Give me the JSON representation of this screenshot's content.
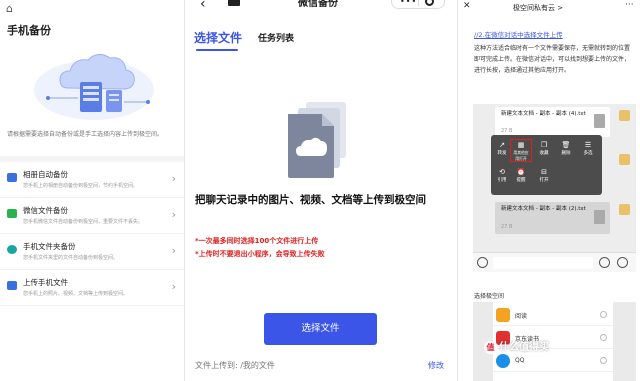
{
  "left": {
    "home_glyph": "⌂",
    "title": "手机备份",
    "description": "请根据需要选择自动备份或是手工选择内容上传到极空间。",
    "items": [
      {
        "name": "相册自动备份",
        "sub": "您手机上的相册自动备份到极空间，节约手机空间。",
        "icon": "album-icon",
        "color": "#3a6fe0"
      },
      {
        "name": "微信文件备份",
        "sub": "您手机微信文件自动备份到极空间，重要文件不丢失。",
        "icon": "wechat-file-icon",
        "color": "#2ab34d"
      },
      {
        "name": "手机文件夹备份",
        "sub": "您手机文件夹里的文件自动备份到极空间。",
        "icon": "folder-sync-icon",
        "color": "#1aa6a0"
      },
      {
        "name": "上传手机文件",
        "sub": "您手机上的照片、视频、文档等上传到极空间。",
        "icon": "upload-folder-icon",
        "color": "#3a6fe0"
      }
    ],
    "chevron": "›"
  },
  "middle": {
    "nav_title": "微信备份",
    "back_glyph": "‹",
    "capsule_dots": "•••",
    "tabs": [
      "选择文件",
      "任务列表"
    ],
    "headline": "把聊天记录中的图片、视频、文档等上传到极空间",
    "warnings": [
      "*一次最多同时选择100个文件进行上传",
      "*上传时不要退出小程序，会导致上传失败"
    ],
    "select_button": "选择文件",
    "upload_to": "文件上传到: /我的文件",
    "modify": "修改",
    "accent": "#3a55e8",
    "warn_color": "#e02020"
  },
  "right": {
    "close_glyph": "✕",
    "title": "极空间私有云 >",
    "more_glyph": "···",
    "section1": "//2.在微信对话中选择文件上传",
    "paragraph": "这种方法适合临时有一个文件需要保存，无需就转到的位置即可完成上传。在微信对话中，可以找到想要上传的文件，进行长按，选择通过其他应用打开。",
    "chat": {
      "bubble1_title": "新建文本文档 - 副本 - 副本 (4).txt",
      "bubble1_size": "27 B",
      "bubble2_title": "新建文本文档 - 副本 - 副本 (2).txt",
      "bubble2_size": "27 B",
      "menu_items": [
        {
          "glyph": "↗",
          "label": "转发"
        },
        {
          "glyph": "▦",
          "label": "用其他应用打开"
        },
        {
          "glyph": "❒",
          "label": "收藏"
        },
        {
          "glyph": "🗑",
          "label": "删除"
        },
        {
          "glyph": "☰",
          "label": "多选"
        },
        {
          "glyph": "⟲",
          "label": "引用"
        },
        {
          "glyph": "⏰",
          "label": "提醒"
        },
        {
          "glyph": "⊟",
          "label": "打开"
        }
      ]
    },
    "section2": "选择极空间",
    "apps": [
      {
        "name": "阅读",
        "color": "#f3a321"
      },
      {
        "name": "京东读书",
        "color": "#e03030"
      },
      {
        "name": "QQ",
        "color": "#1b8fe8"
      }
    ],
    "watermark_badge": "值",
    "watermark": "什么值得买"
  }
}
